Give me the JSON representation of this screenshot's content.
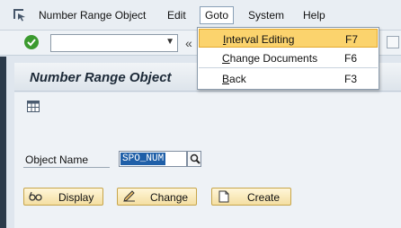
{
  "menubar": {
    "icon": "menu-expand-icon",
    "items": [
      {
        "label": "Number Range Object"
      },
      {
        "label": "Edit"
      },
      {
        "label": "Goto"
      },
      {
        "label": "System"
      },
      {
        "label": "Help"
      }
    ]
  },
  "toolbar": {
    "ok_icon": "green-check-icon",
    "command_value": "",
    "dropdown_arrow": "▼",
    "nav_glyph": "«"
  },
  "screen": {
    "title": "Number Range Object",
    "grid_icon": "table-icon"
  },
  "form": {
    "field_label": "Object Name",
    "field_value": "SPO_NUM"
  },
  "buttons": [
    {
      "label": "Display",
      "icon": "glasses-icon"
    },
    {
      "label": "Change",
      "icon": "pencil-icon"
    },
    {
      "label": "Create",
      "icon": "new-document-icon"
    }
  ],
  "goto_menu": {
    "items": [
      {
        "label_underline": "I",
        "label_rest": "nterval Editing",
        "shortcut": "F7",
        "highlighted": true
      },
      {
        "label_underline": "C",
        "label_rest": "hange Documents",
        "shortcut": "F6",
        "highlighted": false
      },
      {
        "label_underline": "B",
        "label_rest": "ack",
        "shortcut": "F3",
        "highlighted": false
      }
    ]
  },
  "colors": {
    "menu_highlight": "#fbd36d",
    "field_selection": "#1f5fa8",
    "ok_green": "#3b9a2f",
    "button_fill": "#f4dfa2"
  }
}
